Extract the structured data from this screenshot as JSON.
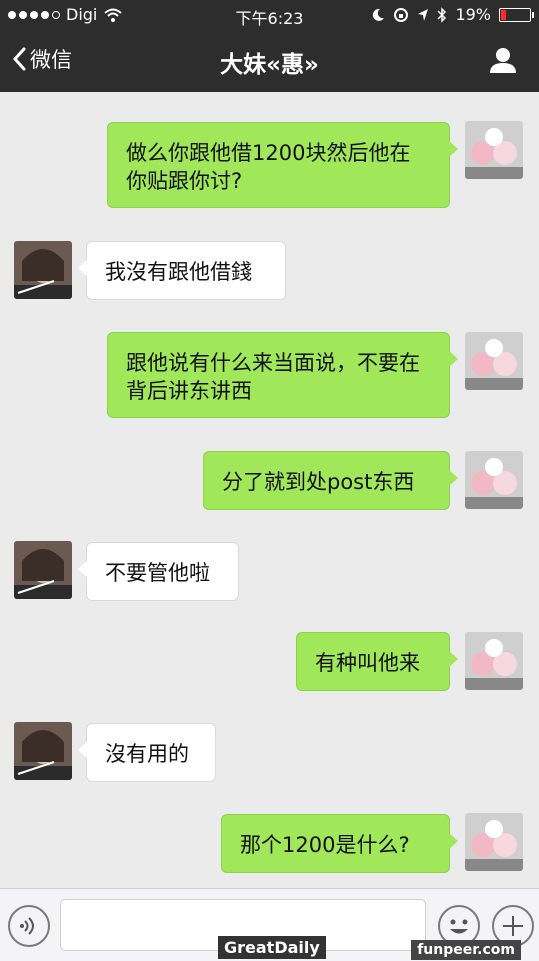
{
  "status_bar": {
    "carrier": "Digi",
    "time": "下午6:23",
    "battery_text": "19%",
    "battery_level": 0.19,
    "accent_battery": "#ff2a2a"
  },
  "nav": {
    "back_label": "微信",
    "title": "大妹«惠»",
    "icons": [
      "chevron-left-icon",
      "person-icon"
    ]
  },
  "messages": [
    {
      "dir": "out",
      "text": "做么你跟他借1200块然后他在你贴跟你讨?"
    },
    {
      "dir": "in",
      "text": "我沒有跟他借錢"
    },
    {
      "dir": "out",
      "text": "跟他说有什么来当面说，不要在背后讲东讲西"
    },
    {
      "dir": "out",
      "text": "分了就到处post东西"
    },
    {
      "dir": "in",
      "text": "不要管他啦"
    },
    {
      "dir": "out",
      "text": "有种叫他来"
    },
    {
      "dir": "in",
      "text": "沒有用的"
    },
    {
      "dir": "out",
      "text": "那个1200是什么?"
    }
  ],
  "input_bar": {
    "icons": [
      "voice-icon",
      "emoji-icon",
      "plus-icon"
    ]
  },
  "watermarks": {
    "left": "GreatDaily",
    "right": "funpeer.com"
  },
  "colors": {
    "outgoing_bubble": "#a0e759",
    "incoming_bubble": "#ffffff",
    "header": "#2d2d2d",
    "background": "#ebebeb"
  }
}
